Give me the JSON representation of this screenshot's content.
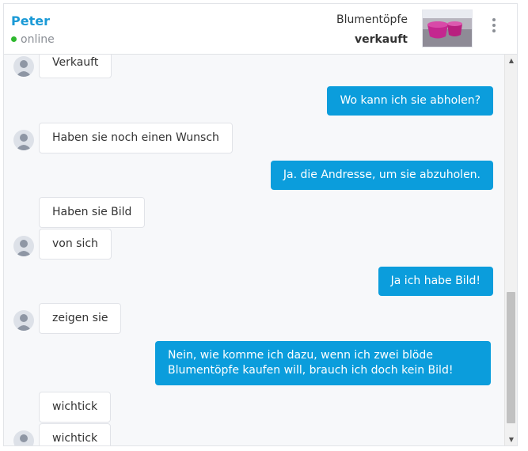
{
  "header": {
    "user_name": "Peter",
    "status": "online",
    "product_title": "Blumentöpfe",
    "product_state": "verkauft"
  },
  "messages": [
    {
      "direction": "in",
      "text": "Verkauft",
      "avatar": true
    },
    {
      "direction": "out",
      "text": "Wo kann ich sie abholen?"
    },
    {
      "direction": "in",
      "text": "Haben sie noch einen Wunsch",
      "avatar": true
    },
    {
      "direction": "out",
      "text": "Ja. die Andresse, um sie abzuholen."
    },
    {
      "direction": "in",
      "text": "Haben sie Bild",
      "avatar": false
    },
    {
      "direction": "in",
      "text": "von sich",
      "avatar": true
    },
    {
      "direction": "out",
      "text": "Ja ich habe Bild!"
    },
    {
      "direction": "in",
      "text": "zeigen sie",
      "avatar": true
    },
    {
      "direction": "out",
      "text": "Nein, wie komme ich dazu, wenn ich zwei blöde Blumentöpfe kaufen will, brauch ich doch kein Bild!"
    },
    {
      "direction": "in",
      "text": "wichtick",
      "avatar": false
    },
    {
      "direction": "in",
      "text": "wichtick",
      "avatar": true
    }
  ],
  "colors": {
    "accent": "#1b9ad6",
    "outgoing_bubble": "#0b9ddc",
    "online_dot": "#2eb82e",
    "chat_background": "#f7f8fa"
  },
  "icons": {
    "menu": "vertical-dots-icon",
    "avatar": "user-silhouette-icon",
    "scroll_up": "triangle-up-icon",
    "scroll_down": "triangle-down-icon"
  }
}
